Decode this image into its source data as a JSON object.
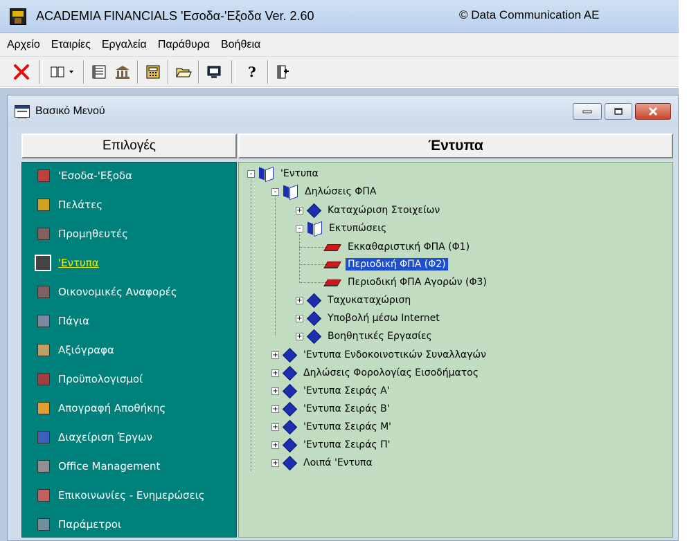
{
  "app": {
    "title": "ACADEMIA FINANCIALS 'Εσοδα-'Εξοδα Ver. 2.60",
    "copyright": "© Data Communication AE"
  },
  "menu": [
    "Αρχείο",
    "Εταιρίες",
    "Εργαλεία",
    "Παράθυρα",
    "Βοήθεια"
  ],
  "child_window": {
    "title": "Βασικό Μενού"
  },
  "left_panel": {
    "header": "Επιλογές",
    "items": [
      {
        "label": "'Εσοδα-'Εξοδα",
        "icon_color": "#c04040"
      },
      {
        "label": "Πελάτες",
        "icon_color": "#d0a020"
      },
      {
        "label": "Προμηθευτές",
        "icon_color": "#806060"
      },
      {
        "label": "'Εντυπα",
        "icon_color": "#444444",
        "active": true
      },
      {
        "label": "Οικονομικές Αναφορές",
        "icon_color": "#806060"
      },
      {
        "label": "Πάγια",
        "icon_color": "#7a8aa0"
      },
      {
        "label": "Αξιόγραφα",
        "icon_color": "#c0a060"
      },
      {
        "label": "Προϋπολογισμοί",
        "icon_color": "#a04040"
      },
      {
        "label": "Απογραφή Αποθήκης",
        "icon_color": "#e0a030"
      },
      {
        "label": "Διαχείριση Έργων",
        "icon_color": "#4060c0"
      },
      {
        "label": "Office Management",
        "icon_color": "#909090"
      },
      {
        "label": "Επικοινωνίες - Ενημερώσεις",
        "icon_color": "#c06060"
      },
      {
        "label": "Παράμετροι",
        "icon_color": "#7090a0"
      }
    ]
  },
  "right_panel": {
    "header": "Έντυπα",
    "tree": [
      {
        "label": "'Εντυπα",
        "icon": "folder-open",
        "expander": "-"
      },
      {
        "label": "Δηλώσεις ΦΠΑ",
        "icon": "folder-open",
        "expander": "-"
      },
      {
        "label": "Καταχώριση Στοιχείων",
        "icon": "folder-closed",
        "expander": "+"
      },
      {
        "label": "Εκτυπώσεις",
        "icon": "folder-open",
        "expander": "-"
      },
      {
        "label": "Εκκαθαριστική ΦΠΑ (Φ1)",
        "icon": "document",
        "expander": ""
      },
      {
        "label": "Περιοδική ΦΠΑ (Φ2)",
        "icon": "document",
        "expander": "",
        "selected": true
      },
      {
        "label": "Περιοδική ΦΠΑ Αγορών (Φ3)",
        "icon": "document",
        "expander": ""
      },
      {
        "label": "Ταχυκαταχώριση",
        "icon": "folder-closed",
        "expander": "+"
      },
      {
        "label": "Υποβολή μέσω Internet",
        "icon": "folder-closed",
        "expander": "+"
      },
      {
        "label": "Βοηθητικές Εργασίες",
        "icon": "folder-closed",
        "expander": "+"
      },
      {
        "label": "'Εντυπα Ενδοκοινοτικών Συναλλαγών",
        "icon": "folder-closed",
        "expander": "+"
      },
      {
        "label": "Δηλώσεις Φορολογίας Εισοδήματος",
        "icon": "folder-closed",
        "expander": "+"
      },
      {
        "label": "'Εντυπα Σειράς Α'",
        "icon": "folder-closed",
        "expander": "+"
      },
      {
        "label": "'Εντυπα Σειράς Β'",
        "icon": "folder-closed",
        "expander": "+"
      },
      {
        "label": "'Εντυπα Σειράς Μ'",
        "icon": "folder-closed",
        "expander": "+"
      },
      {
        "label": "'Εντυπα Σειράς Π'",
        "icon": "folder-closed",
        "expander": "+"
      },
      {
        "label": "Λοιπά 'Εντυπα",
        "icon": "folder-closed",
        "expander": "+"
      }
    ]
  },
  "toolbar": {
    "buttons": [
      "close-icon",
      "view-toggle-icon",
      "list-icon",
      "bank-icon",
      "calculator-icon",
      "open-folder-icon",
      "monitor-icon",
      "help-icon",
      "exit-icon"
    ]
  },
  "colors": {
    "left_panel_bg": "#00807a",
    "right_panel_bg": "#c2dcc2",
    "active_label": "#f0f000",
    "selection_bg": "#1d4fd0"
  }
}
